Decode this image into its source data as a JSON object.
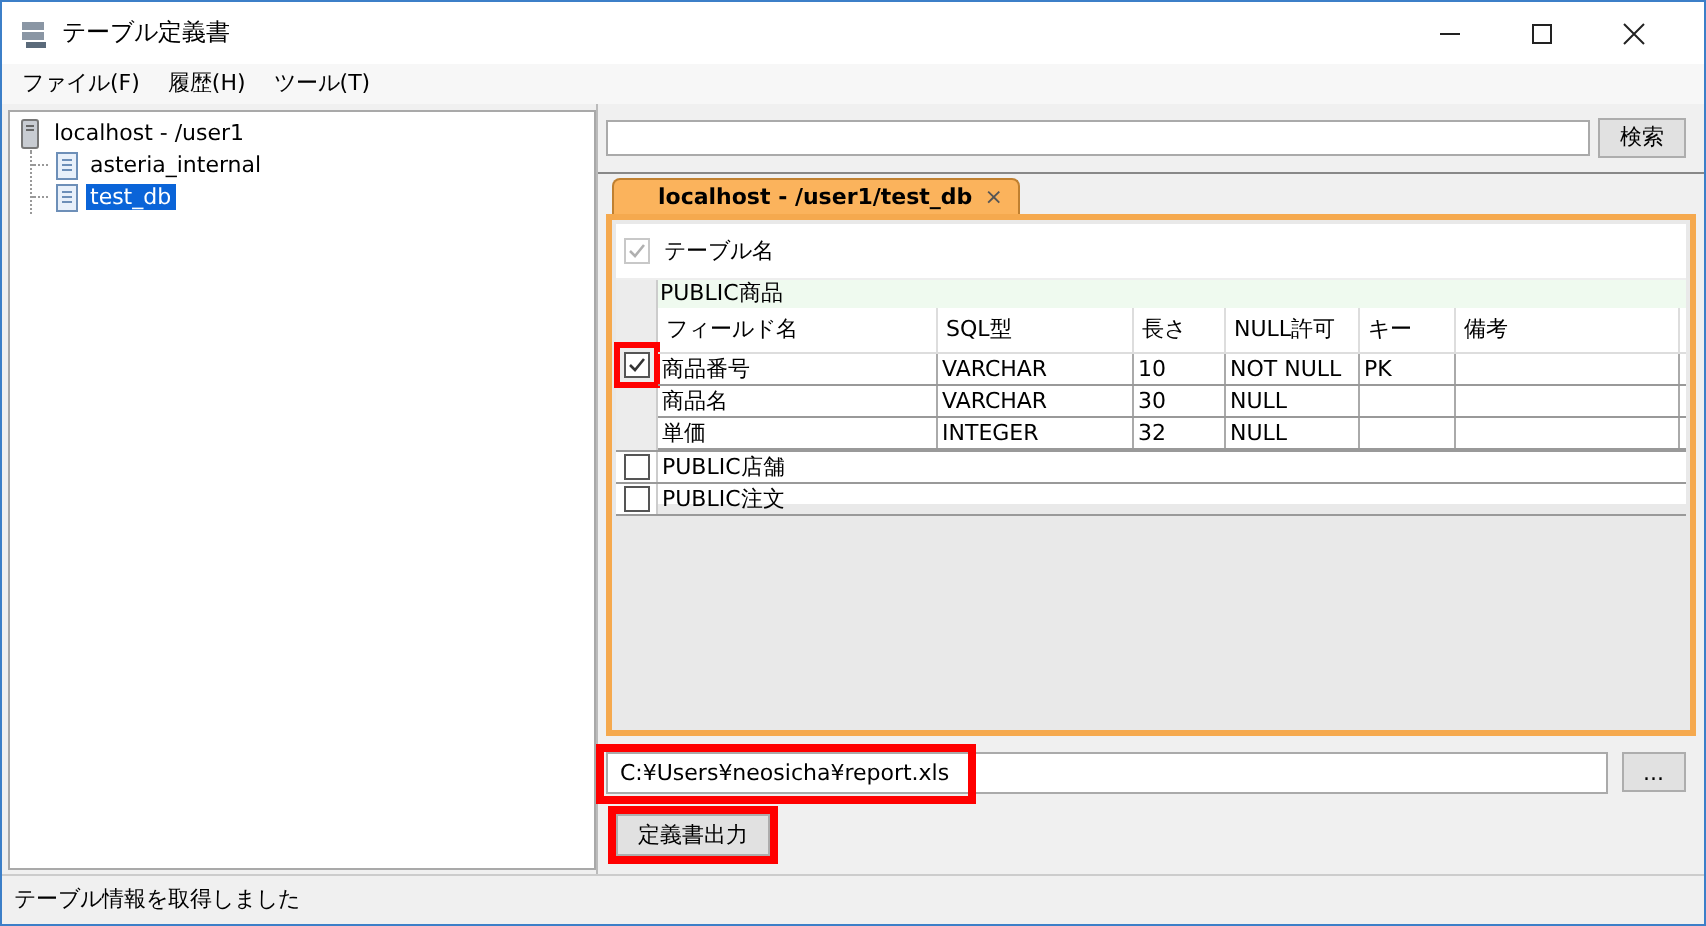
{
  "window": {
    "title": "テーブル定義書"
  },
  "menu": [
    "ファイル(F)",
    "履歴(H)",
    "ツール(T)"
  ],
  "tree": [
    {
      "label": "localhost - /user1",
      "kind": "server",
      "children": [
        {
          "label": "asteria_internal",
          "kind": "database",
          "selected": false
        },
        {
          "label": "test_db",
          "kind": "database",
          "selected": true
        }
      ]
    }
  ],
  "search": {
    "button": "検索"
  },
  "tabs": [
    {
      "label": "localhost - /user1/test_db",
      "close": "×",
      "selected": true
    }
  ],
  "table": {
    "header_checkbox": {
      "checked": true,
      "disabled": true
    },
    "header": "テーブル名",
    "groups": [
      {
        "name": "PUBLIC商品",
        "checked": true,
        "expanded": true,
        "highlighted": true,
        "columns": [
          "フィールド名",
          "SQL型",
          "長さ",
          "NULL許可",
          "キー",
          "備考"
        ],
        "rows": [
          [
            "商品番号",
            "VARCHAR",
            "10",
            "NOT NULL",
            "PK",
            ""
          ],
          [
            "商品名",
            "VARCHAR",
            "30",
            "NULL",
            "",
            ""
          ],
          [
            "単価",
            "INTEGER",
            "32",
            "NULL",
            "",
            ""
          ]
        ]
      },
      {
        "name": "PUBLIC店舗",
        "checked": false,
        "expanded": false,
        "highlighted": false
      },
      {
        "name": "PUBLIC注文",
        "checked": false,
        "expanded": false,
        "highlighted": false
      }
    ]
  },
  "output": {
    "path": "C:¥Users¥neosicha¥report.xls",
    "path_highlighted": true,
    "browse_button": "...",
    "export_button": "定義書出力",
    "export_highlighted": true
  },
  "status_bar": "テーブル情報を取得しました"
}
